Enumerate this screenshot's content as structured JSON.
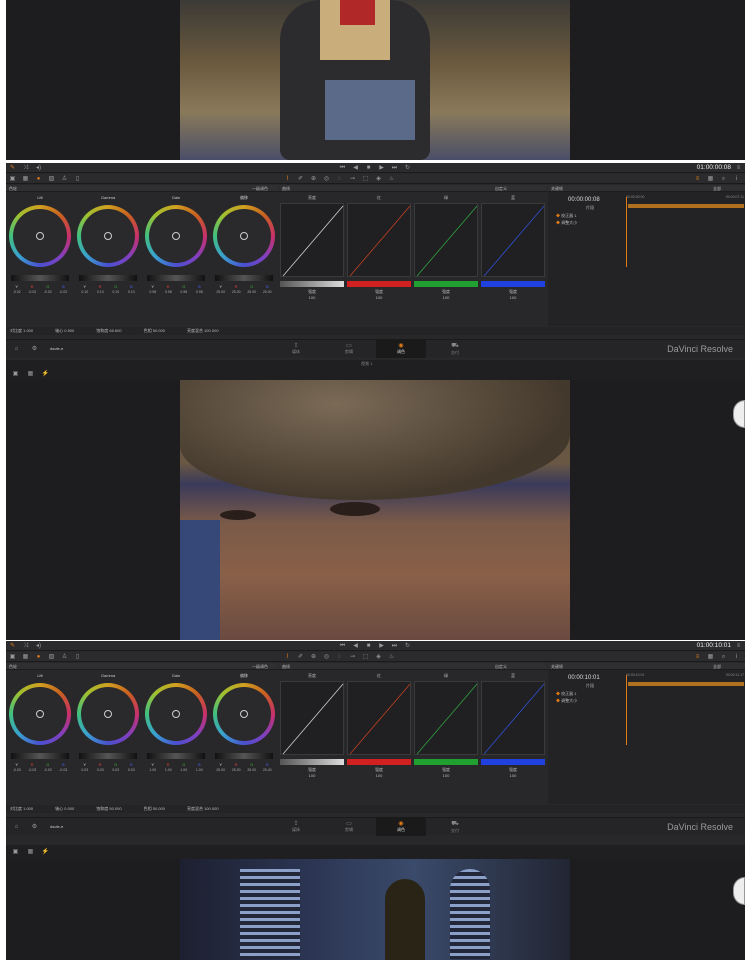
{
  "panel1": {
    "timecode": "01:00:00:08",
    "wheel_header": "色轮",
    "wheel_mode": "一级调色",
    "curve_header": "曲线",
    "curve_mode": "自定义",
    "keyframe_header": "关键帧",
    "keyframe_mode": "全部",
    "kf_timecode": "00:00:00:08",
    "kf_clip": "片段",
    "kf_track1": "校正器 1",
    "kf_track2": "调整大小",
    "kf_ruler1": "00:00:00:00",
    "kf_ruler2": "00:00:07:11",
    "wheels": [
      {
        "label": "Lift",
        "values": [
          "-0.02",
          "-0.02",
          "-0.02",
          "-0.02"
        ]
      },
      {
        "label": "Gamma",
        "values": [
          "0.10",
          "0.10",
          "0.10",
          "0.10"
        ]
      },
      {
        "label": "Gain",
        "values": [
          "0.98",
          "0.98",
          "0.98",
          "0.98"
        ]
      },
      {
        "label": "偏移",
        "values": [
          "25.00",
          "25.00",
          "25.00",
          "25.00"
        ]
      }
    ],
    "curves": [
      {
        "label": "亮度",
        "color": "#d0d0d0",
        "intensity_label": "强度",
        "intensity": "100"
      },
      {
        "label": "红",
        "color": "#e04040",
        "intensity_label": "强度",
        "intensity": "100"
      },
      {
        "label": "绿",
        "color": "#40b040",
        "intensity_label": "强度",
        "intensity": "100"
      },
      {
        "label": "蓝",
        "color": "#4060e0",
        "intensity_label": "强度",
        "intensity": "100"
      }
    ],
    "status": [
      "对比度 1.000",
      "轴心 0.500",
      "饱和度 65.600",
      "色相 50.000",
      "亮度混合 100.000"
    ],
    "clip_name": "dsofe-e",
    "pages": [
      "媒体",
      "剪辑",
      "调色",
      "交付"
    ],
    "active_page": "调色",
    "brand": "DaVinci Resolve",
    "subtrack": "视频 1"
  },
  "panel2": {
    "timecode": "01:00:10:01",
    "wheel_header": "色轮",
    "wheel_mode": "一级调色",
    "curve_header": "曲线",
    "curve_mode": "自定义",
    "keyframe_header": "关键帧",
    "keyframe_mode": "全部",
    "kf_timecode": "00:00:10:01",
    "kf_clip": "片段",
    "kf_track1": "校正器 1",
    "kf_track2": "调整大小",
    "kf_ruler1": "00:00:10:01",
    "kf_ruler2": "00:00:11:17",
    "wheels": [
      {
        "label": "Lift",
        "values": [
          "-0.03",
          "-0.03",
          "-0.03",
          "-0.03"
        ]
      },
      {
        "label": "Gamma",
        "values": [
          "0.03",
          "0.03",
          "0.03",
          "0.03"
        ]
      },
      {
        "label": "Gain",
        "values": [
          "1.00",
          "1.00",
          "1.00",
          "1.00"
        ]
      },
      {
        "label": "偏移",
        "values": [
          "25.00",
          "25.00",
          "25.00",
          "25.40"
        ]
      }
    ],
    "curves": [
      {
        "label": "亮度",
        "color": "#d0d0d0",
        "intensity_label": "强度",
        "intensity": "100"
      },
      {
        "label": "红",
        "color": "#e04040",
        "intensity_label": "强度",
        "intensity": "100"
      },
      {
        "label": "绿",
        "color": "#40b040",
        "intensity_label": "强度",
        "intensity": "100"
      },
      {
        "label": "蓝",
        "color": "#4060e0",
        "intensity_label": "强度",
        "intensity": "100"
      }
    ],
    "status": [
      "对比度 1.000",
      "轴心 0.000",
      "饱和度 50.000",
      "色相 50.000",
      "亮度混合 100.000"
    ],
    "clip_name": "dsofe-e",
    "pages": [
      "媒体",
      "剪辑",
      "调色",
      "交付"
    ],
    "active_page": "调色",
    "brand": "DaVinci Resolve"
  },
  "channel_letters": [
    "Y",
    "R",
    "G",
    "B"
  ],
  "accent_color": "#e07b1a"
}
